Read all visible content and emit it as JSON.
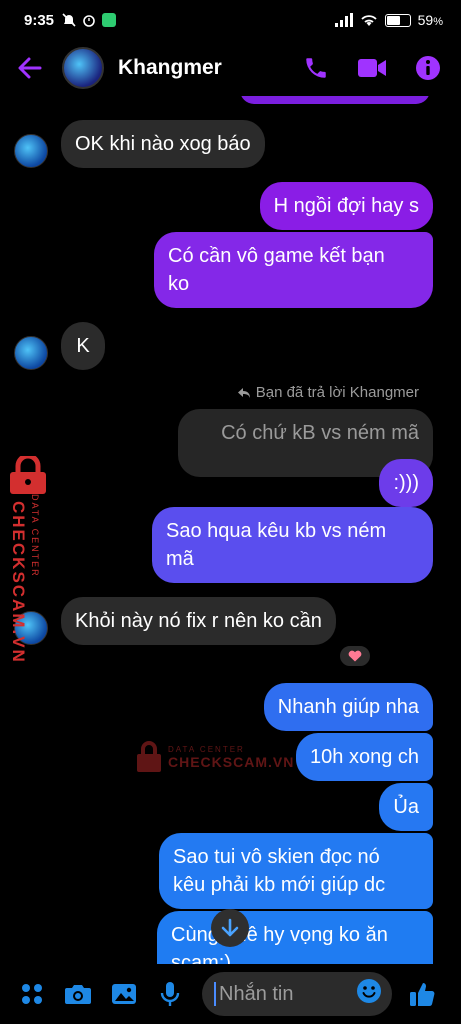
{
  "status_bar": {
    "time": "9:35",
    "battery": "59",
    "battery_unit": "%"
  },
  "header": {
    "contact_name": "Khangmer"
  },
  "messages": [
    {
      "id": "m1",
      "dir": "in",
      "text": "OK khi nào xog báo"
    },
    {
      "id": "m2",
      "dir": "out",
      "text": "H ngồi đợi hay s"
    },
    {
      "id": "m3",
      "dir": "out",
      "text_lines": [
        "Có cần vô game kết bạn",
        "ko"
      ]
    },
    {
      "id": "m4",
      "dir": "in",
      "text": "K"
    },
    {
      "id": "m5",
      "dir": "out",
      "reply_note": "Bạn đã trả lời Khangmer",
      "quoted": "Có chứ kB vs ném mã",
      "text": ":)))"
    },
    {
      "id": "m6",
      "dir": "out",
      "text_lines": [
        "Sao hqua kêu kb vs ném",
        "mã"
      ]
    },
    {
      "id": "m7",
      "dir": "in",
      "text": "Khỏi này nó fix r nên ko cần",
      "reaction": "heart"
    },
    {
      "id": "m8",
      "dir": "out",
      "text": "Nhanh giúp nha"
    },
    {
      "id": "m9",
      "dir": "out",
      "text": "10h xong ch"
    },
    {
      "id": "m10",
      "dir": "out",
      "text": "Ủa"
    },
    {
      "id": "m11",
      "dir": "out",
      "text_lines": [
        "Sao tui vô skien đọc nó",
        "kêu phải kb mới giúp dc"
      ]
    },
    {
      "id": "m12",
      "dir": "out",
      "text_lines": [
        "Cùng quê hy vọng ko ăn",
        "scam:)"
      ]
    }
  ],
  "watermark": {
    "brand": "CHECKSCAM.VN",
    "tag": "DATA CENTER"
  },
  "composer": {
    "placeholder": "Nhắn tin"
  },
  "colors": {
    "accent": "#a033ff",
    "bubble_in": "#2b2b2b",
    "grad_top": "#8a1de6",
    "grad_bottom": "#1f7cf2",
    "watermark": "#d32f2f"
  },
  "icons": [
    "back-arrow-icon",
    "phone-icon",
    "video-icon",
    "info-icon",
    "apps-icon",
    "camera-icon",
    "image-icon",
    "mic-icon",
    "emoji-icon",
    "like-icon",
    "scroll-down-icon",
    "reply-icon",
    "heart-icon"
  ]
}
